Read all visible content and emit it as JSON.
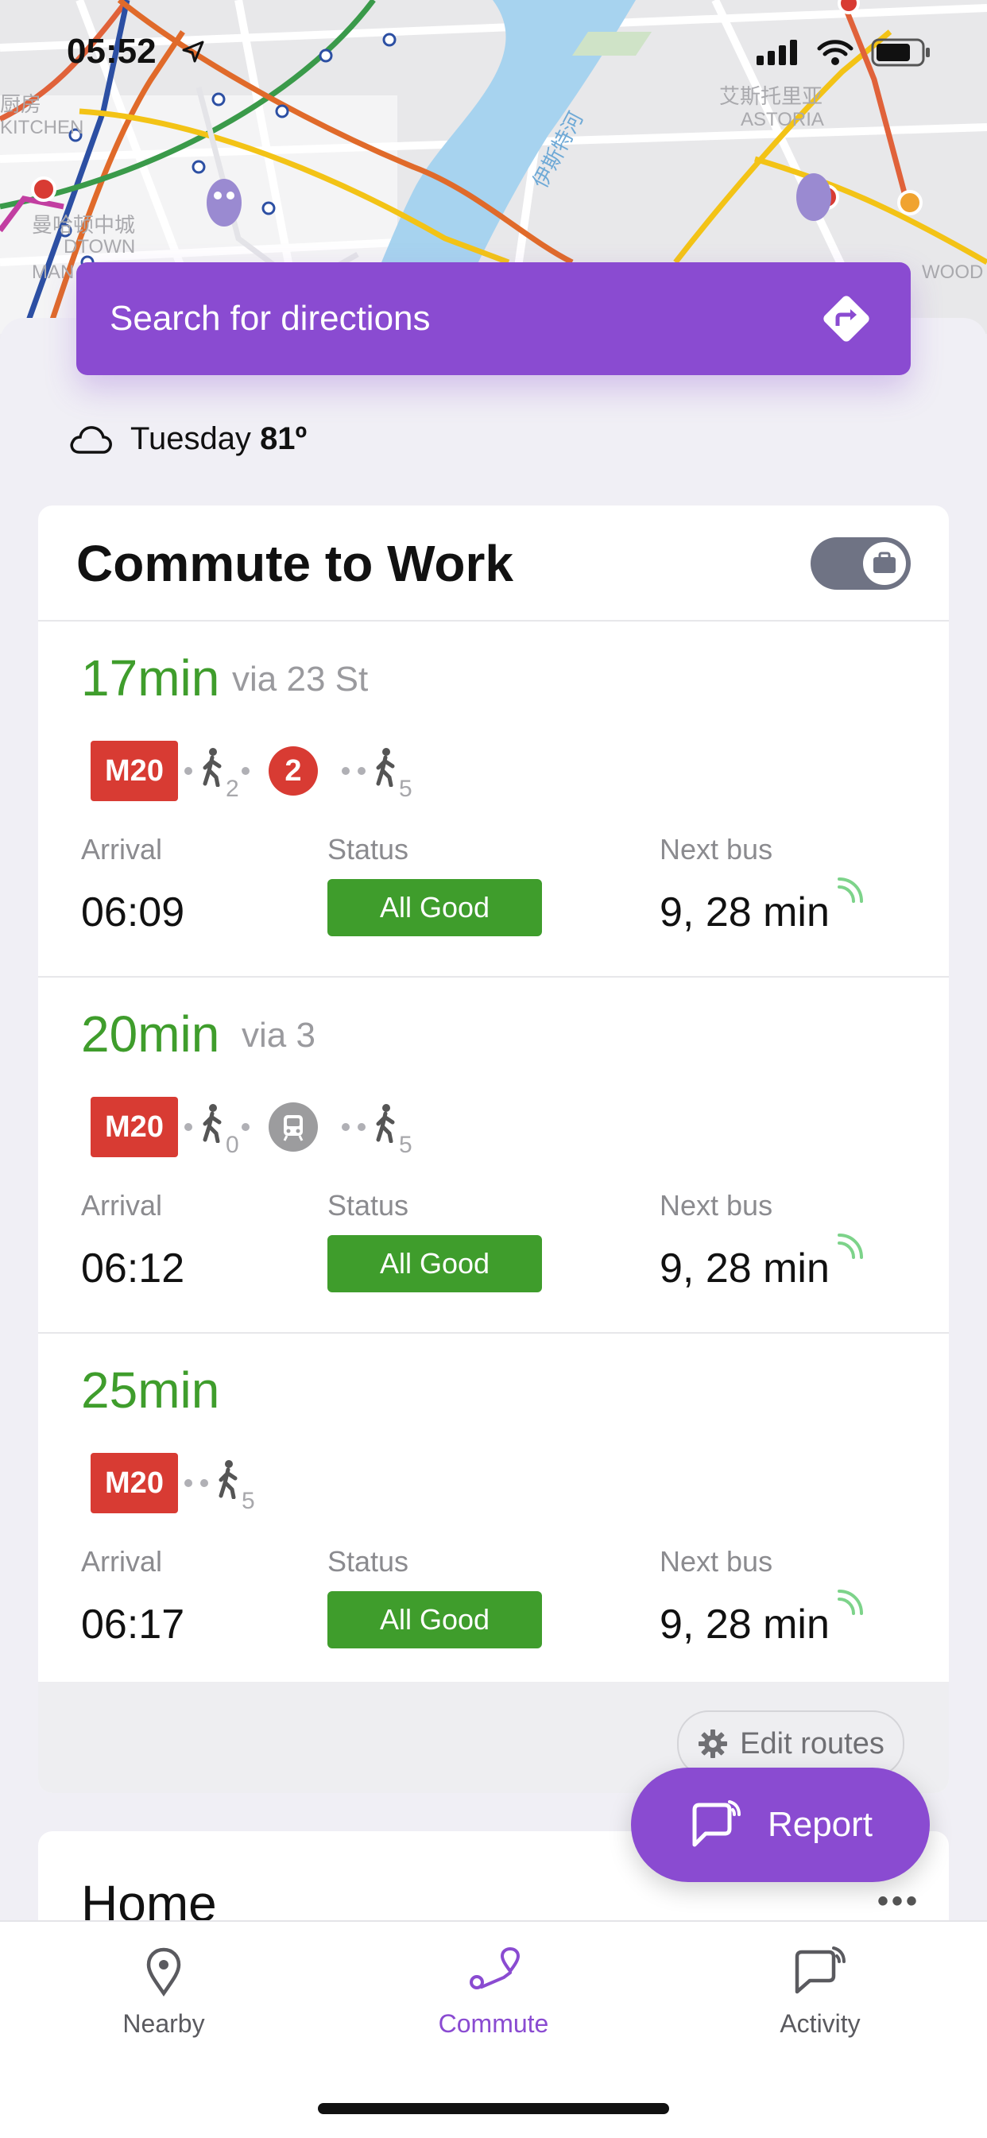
{
  "status_bar": {
    "time": "05:52"
  },
  "map": {
    "labels": [
      "厨房",
      "KITCHEN",
      "曼哈顿中城",
      "DTOWN",
      "MAN",
      "伊斯特河",
      "艾斯托里亚",
      "ASTORIA",
      "WOOD"
    ]
  },
  "search": {
    "placeholder": "Search for directions",
    "icon": "directions-diamond-icon"
  },
  "weather": {
    "day": "Tuesday",
    "temp": "81º",
    "icon": "cloud-icon"
  },
  "commute_card": {
    "title": "Commute to Work",
    "toggle_icon": "briefcase-icon",
    "arrival_label": "Arrival",
    "status_label": "Status",
    "next_bus_label": "Next bus",
    "routes": [
      {
        "duration": "17min",
        "via": "via 23 St",
        "bus": "M20",
        "walk1": "2",
        "line": "2",
        "walk2": "5",
        "arrival": "06:09",
        "status": "All Good",
        "next_bus": "9, 28 min"
      },
      {
        "duration": "20min",
        "via": "via 3",
        "bus": "M20",
        "walk1": "0",
        "line": "",
        "walk2": "5",
        "arrival": "06:12",
        "status": "All Good",
        "next_bus": "9, 28 min"
      },
      {
        "duration": "25min",
        "via": "",
        "bus": "M20",
        "walk1": "",
        "line": "",
        "walk2": "5",
        "arrival": "06:17",
        "status": "All Good",
        "next_bus": "9, 28 min"
      }
    ],
    "edit_routes_label": "Edit routes"
  },
  "home_card": {
    "title": "Home"
  },
  "report_button": {
    "label": "Report"
  },
  "tabs": [
    {
      "label": "Nearby",
      "icon": "location-pin-icon"
    },
    {
      "label": "Commute",
      "icon": "commute-route-icon"
    },
    {
      "label": "Activity",
      "icon": "activity-chat-icon"
    }
  ],
  "colors": {
    "accent": "#8a4bd1",
    "good": "#3f9d2c",
    "line_red": "#d83b33"
  }
}
